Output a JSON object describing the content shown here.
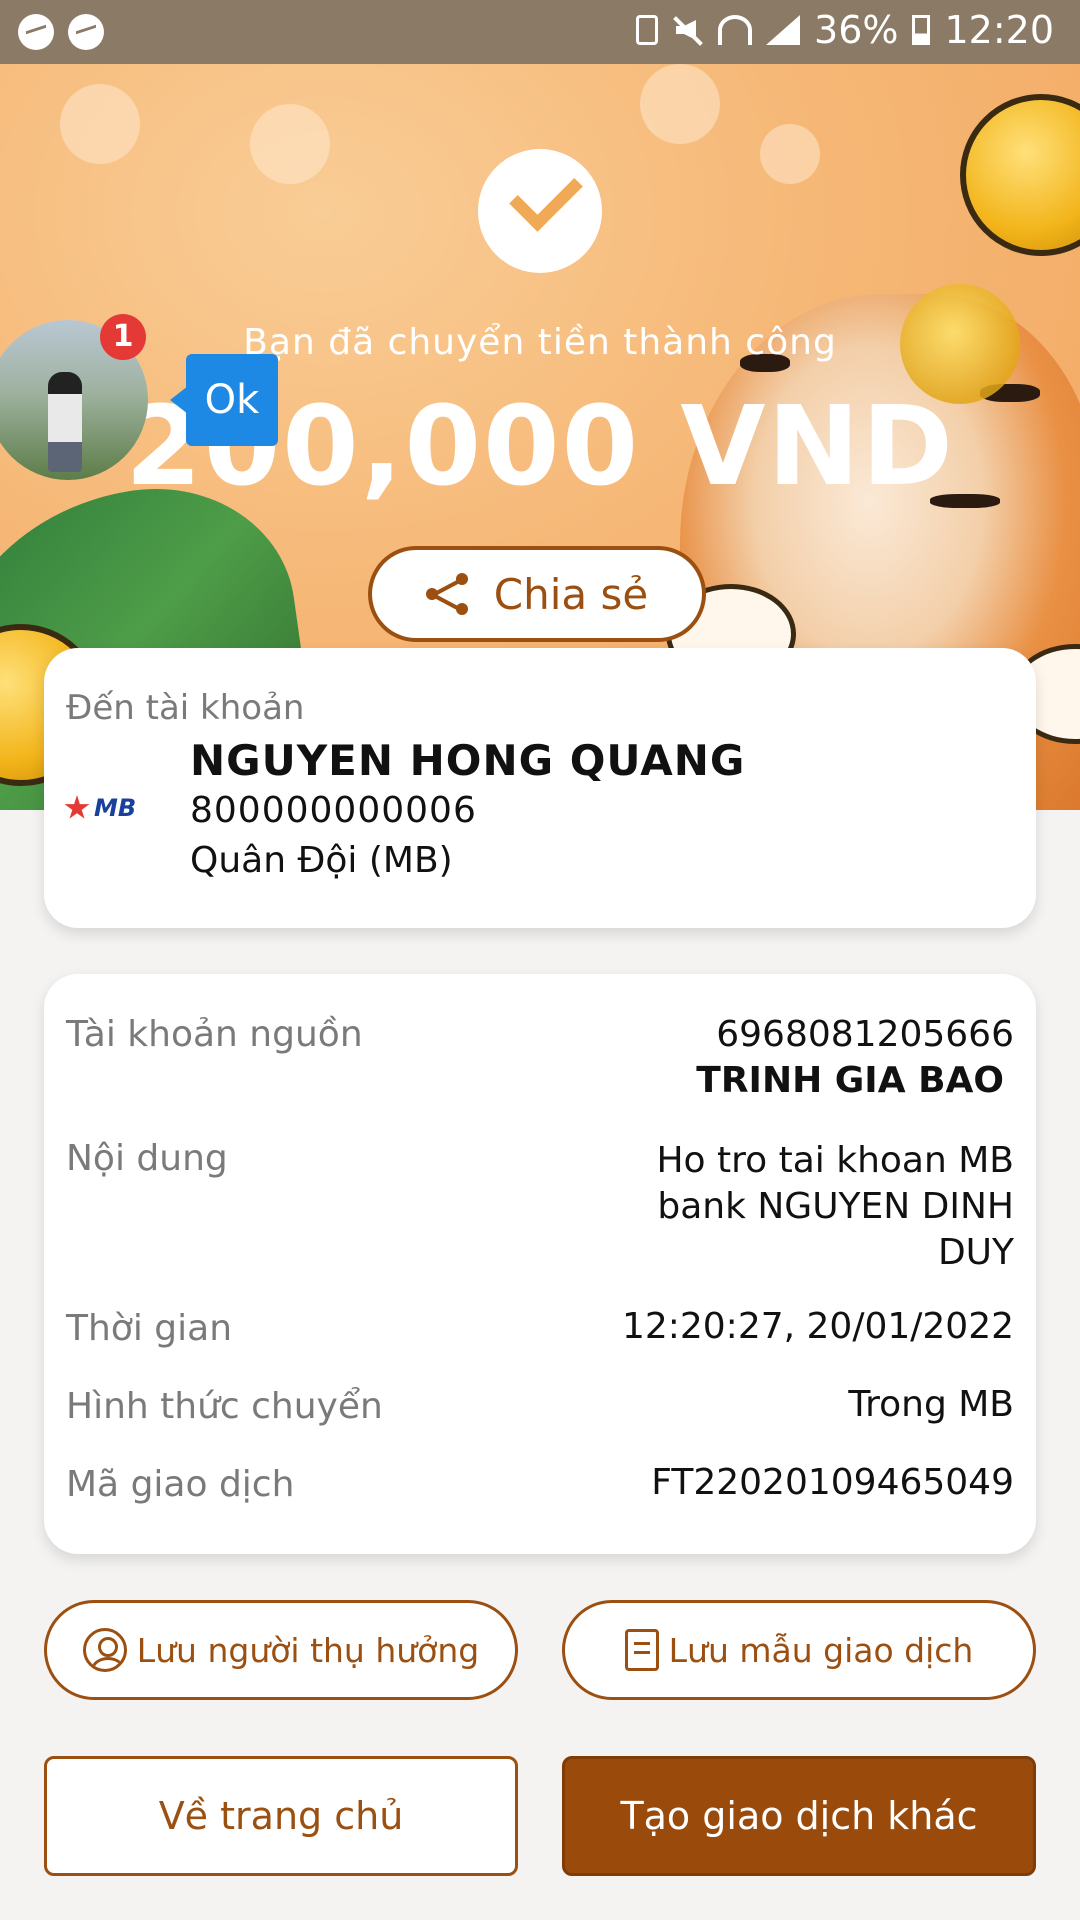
{
  "status_bar": {
    "battery": "36%",
    "time": "12:20"
  },
  "hero": {
    "success_message": "Bạn đã chuyển tiền thành công",
    "amount": "200,000 VND",
    "share_label": "Chia sẻ"
  },
  "chat_head": {
    "badge_count": "1",
    "bubble_text": "Ok"
  },
  "destination": {
    "label": "Đến tài khoản",
    "bank_logo_text": "MB",
    "name": "NGUYEN HONG QUANG",
    "account_number": "800000000006",
    "bank_name": "Quân Đội (MB)"
  },
  "details": {
    "source_label": "Tài khoản nguồn",
    "source_account": "6968081205666",
    "source_name": "TRINH GIA BAO",
    "content_label": "Nội dung",
    "content_lines": [
      "Ho tro tai khoan MB",
      "bank NGUYEN DINH",
      "DUY"
    ],
    "time_label": "Thời gian",
    "time_value": "12:20:27, 20/01/2022",
    "method_label": "Hình thức chuyển",
    "method_value": "Trong MB",
    "code_label": "Mã giao dịch",
    "code_value": "FT22020109465049"
  },
  "actions": {
    "save_beneficiary": "Lưu người thụ hưởng",
    "save_template": "Lưu mẫu giao dịch",
    "home": "Về trang chủ",
    "new_transaction": "Tạo giao dịch khác"
  },
  "colors": {
    "accent": "#9b4f11",
    "primary_button": "#9a4b0c",
    "hero_bg": "#f6b877"
  }
}
